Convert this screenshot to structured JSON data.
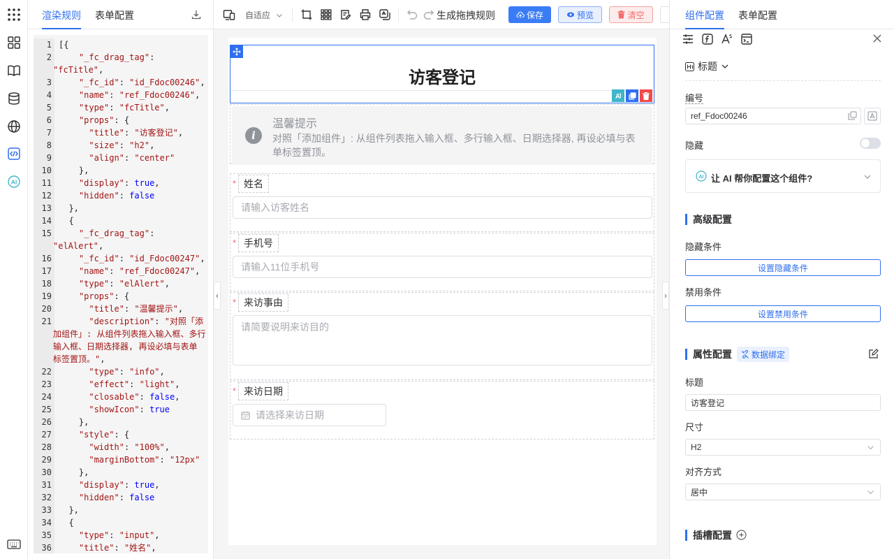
{
  "left_tabs": {
    "render_rules": "渲染规则",
    "form_config": "表单配置"
  },
  "code_lines": [
    {
      "n": "1",
      "parts": [
        [
          "t",
          "[{"
        ]
      ]
    },
    {
      "n": "2",
      "parts": [
        [
          "t",
          "    "
        ],
        [
          "k",
          "\"_fc_drag_tag\""
        ],
        [
          "t",
          ":"
        ]
      ]
    },
    {
      "n": "",
      "parts": [
        [
          "s",
          "\"fcTitle\""
        ],
        [
          "t",
          ","
        ]
      ]
    },
    {
      "n": "3",
      "parts": [
        [
          "t",
          "    "
        ],
        [
          "k",
          "\"_fc_id\""
        ],
        [
          "t",
          ": "
        ],
        [
          "s",
          "\"id_Fdoc00246\""
        ],
        [
          "t",
          ","
        ]
      ]
    },
    {
      "n": "4",
      "parts": [
        [
          "t",
          "    "
        ],
        [
          "k",
          "\"name\""
        ],
        [
          "t",
          ": "
        ],
        [
          "s",
          "\"ref_Fdoc00246\""
        ],
        [
          "t",
          ","
        ]
      ]
    },
    {
      "n": "5",
      "parts": [
        [
          "t",
          "    "
        ],
        [
          "k",
          "\"type\""
        ],
        [
          "t",
          ": "
        ],
        [
          "s",
          "\"fcTitle\""
        ],
        [
          "t",
          ","
        ]
      ]
    },
    {
      "n": "6",
      "parts": [
        [
          "t",
          "    "
        ],
        [
          "k",
          "\"props\""
        ],
        [
          "t",
          ": {"
        ]
      ]
    },
    {
      "n": "7",
      "parts": [
        [
          "t",
          "      "
        ],
        [
          "k",
          "\"title\""
        ],
        [
          "t",
          ": "
        ],
        [
          "s",
          "\"访客登记\""
        ],
        [
          "t",
          ","
        ]
      ]
    },
    {
      "n": "8",
      "parts": [
        [
          "t",
          "      "
        ],
        [
          "k",
          "\"size\""
        ],
        [
          "t",
          ": "
        ],
        [
          "s",
          "\"h2\""
        ],
        [
          "t",
          ","
        ]
      ]
    },
    {
      "n": "9",
      "parts": [
        [
          "t",
          "      "
        ],
        [
          "k",
          "\"align\""
        ],
        [
          "t",
          ": "
        ],
        [
          "s",
          "\"center\""
        ]
      ]
    },
    {
      "n": "10",
      "parts": [
        [
          "t",
          "    },"
        ]
      ]
    },
    {
      "n": "11",
      "parts": [
        [
          "t",
          "    "
        ],
        [
          "k",
          "\"display\""
        ],
        [
          "t",
          ": "
        ],
        [
          "b",
          "true"
        ],
        [
          "t",
          ","
        ]
      ]
    },
    {
      "n": "12",
      "parts": [
        [
          "t",
          "    "
        ],
        [
          "k",
          "\"hidden\""
        ],
        [
          "t",
          ": "
        ],
        [
          "b",
          "false"
        ]
      ]
    },
    {
      "n": "13",
      "parts": [
        [
          "t",
          "  },"
        ]
      ]
    },
    {
      "n": "14",
      "parts": [
        [
          "t",
          "  {"
        ]
      ]
    },
    {
      "n": "15",
      "parts": [
        [
          "t",
          "    "
        ],
        [
          "k",
          "\"_fc_drag_tag\""
        ],
        [
          "t",
          ":"
        ]
      ]
    },
    {
      "n": "",
      "parts": [
        [
          "s",
          "\"elAlert\""
        ],
        [
          "t",
          ","
        ]
      ]
    },
    {
      "n": "16",
      "parts": [
        [
          "t",
          "    "
        ],
        [
          "k",
          "\"_fc_id\""
        ],
        [
          "t",
          ": "
        ],
        [
          "s",
          "\"id_Fdoc00247\""
        ],
        [
          "t",
          ","
        ]
      ]
    },
    {
      "n": "17",
      "parts": [
        [
          "t",
          "    "
        ],
        [
          "k",
          "\"name\""
        ],
        [
          "t",
          ": "
        ],
        [
          "s",
          "\"ref_Fdoc00247\""
        ],
        [
          "t",
          ","
        ]
      ]
    },
    {
      "n": "18",
      "parts": [
        [
          "t",
          "    "
        ],
        [
          "k",
          "\"type\""
        ],
        [
          "t",
          ": "
        ],
        [
          "s",
          "\"elAlert\""
        ],
        [
          "t",
          ","
        ]
      ]
    },
    {
      "n": "19",
      "parts": [
        [
          "t",
          "    "
        ],
        [
          "k",
          "\"props\""
        ],
        [
          "t",
          ": {"
        ]
      ]
    },
    {
      "n": "20",
      "parts": [
        [
          "t",
          "      "
        ],
        [
          "k",
          "\"title\""
        ],
        [
          "t",
          ": "
        ],
        [
          "s",
          "\"温馨提示\""
        ],
        [
          "t",
          ","
        ]
      ]
    },
    {
      "n": "21",
      "parts": [
        [
          "t",
          "      "
        ],
        [
          "k",
          "\"description\""
        ],
        [
          "t",
          ": "
        ],
        [
          "s",
          "\"对照「添"
        ]
      ]
    },
    {
      "n": "",
      "parts": [
        [
          "s",
          "加组件」: 从组件列表拖入输入框、多行"
        ]
      ]
    },
    {
      "n": "",
      "parts": [
        [
          "s",
          "输入框、日期选择器, 再设必填与表单"
        ]
      ]
    },
    {
      "n": "",
      "parts": [
        [
          "s",
          "标签置顶。\""
        ],
        [
          "t",
          ","
        ]
      ]
    },
    {
      "n": "22",
      "parts": [
        [
          "t",
          "      "
        ],
        [
          "k",
          "\"type\""
        ],
        [
          "t",
          ": "
        ],
        [
          "s",
          "\"info\""
        ],
        [
          "t",
          ","
        ]
      ]
    },
    {
      "n": "23",
      "parts": [
        [
          "t",
          "      "
        ],
        [
          "k",
          "\"effect\""
        ],
        [
          "t",
          ": "
        ],
        [
          "s",
          "\"light\""
        ],
        [
          "t",
          ","
        ]
      ]
    },
    {
      "n": "24",
      "parts": [
        [
          "t",
          "      "
        ],
        [
          "k",
          "\"closable\""
        ],
        [
          "t",
          ": "
        ],
        [
          "b",
          "false"
        ],
        [
          "t",
          ","
        ]
      ]
    },
    {
      "n": "25",
      "parts": [
        [
          "t",
          "      "
        ],
        [
          "k",
          "\"showIcon\""
        ],
        [
          "t",
          ": "
        ],
        [
          "b",
          "true"
        ]
      ]
    },
    {
      "n": "26",
      "parts": [
        [
          "t",
          "    },"
        ]
      ]
    },
    {
      "n": "27",
      "parts": [
        [
          "t",
          "    "
        ],
        [
          "k",
          "\"style\""
        ],
        [
          "t",
          ": {"
        ]
      ]
    },
    {
      "n": "28",
      "parts": [
        [
          "t",
          "      "
        ],
        [
          "k",
          "\"width\""
        ],
        [
          "t",
          ": "
        ],
        [
          "s",
          "\"100%\""
        ],
        [
          "t",
          ","
        ]
      ]
    },
    {
      "n": "29",
      "parts": [
        [
          "t",
          "      "
        ],
        [
          "k",
          "\"marginBottom\""
        ],
        [
          "t",
          ": "
        ],
        [
          "s",
          "\"12px\""
        ]
      ]
    },
    {
      "n": "30",
      "parts": [
        [
          "t",
          "    },"
        ]
      ]
    },
    {
      "n": "31",
      "parts": [
        [
          "t",
          "    "
        ],
        [
          "k",
          "\"display\""
        ],
        [
          "t",
          ": "
        ],
        [
          "b",
          "true"
        ],
        [
          "t",
          ","
        ]
      ]
    },
    {
      "n": "32",
      "parts": [
        [
          "t",
          "    "
        ],
        [
          "k",
          "\"hidden\""
        ],
        [
          "t",
          ": "
        ],
        [
          "b",
          "false"
        ]
      ]
    },
    {
      "n": "33",
      "parts": [
        [
          "t",
          "  },"
        ]
      ]
    },
    {
      "n": "34",
      "parts": [
        [
          "t",
          "  {"
        ]
      ]
    },
    {
      "n": "35",
      "parts": [
        [
          "t",
          "    "
        ],
        [
          "k",
          "\"type\""
        ],
        [
          "t",
          ": "
        ],
        [
          "s",
          "\"input\""
        ],
        [
          "t",
          ","
        ]
      ]
    },
    {
      "n": "36",
      "parts": [
        [
          "t",
          "    "
        ],
        [
          "k",
          "\"title\""
        ],
        [
          "t",
          ": "
        ],
        [
          "s",
          "\"姓名\""
        ],
        [
          "t",
          ","
        ]
      ]
    }
  ],
  "toolbar": {
    "adaptive": "自适应",
    "generate": "生成拖拽规则",
    "save": "保存",
    "preview": "预览",
    "clear": "清空"
  },
  "form": {
    "title": "访客登记",
    "alert_title": "温馨提示",
    "alert_desc": "对照「添加组件」: 从组件列表拖入输入框、多行输入框、日期选择器, 再设必填与表单标签置顶。",
    "alert_icon": "i",
    "required_mark": "*",
    "fields": {
      "name_label": "姓名",
      "name_placeholder": "请输入访客姓名",
      "phone_label": "手机号",
      "phone_placeholder": "请输入11位手机号",
      "reason_label": "来访事由",
      "reason_placeholder": "请简要说明来访目的",
      "date_label": "来访日期",
      "date_placeholder": "请选择来访日期"
    }
  },
  "right": {
    "tab_component": "组件配置",
    "tab_form": "表单配置",
    "component_type": "标题",
    "id_label": "编号",
    "id_value": "ref_Fdoc00246",
    "hidden_label": "隐藏",
    "ai_prompt": "让 AI 帮你配置这个组件?",
    "advanced": "高级配置",
    "hide_condition": "隐藏条件",
    "set_hide_condition": "设置隐藏条件",
    "disable_condition": "禁用条件",
    "set_disable_condition": "设置禁用条件",
    "props": "属性配置",
    "data_binding": "数据绑定",
    "title_label": "标题",
    "title_value": "访客登记",
    "size_label": "尺寸",
    "size_value": "H2",
    "align_label": "对齐方式",
    "align_value": "居中",
    "slot": "插槽配置"
  },
  "colors": {
    "accent": "#2f6fee",
    "danger": "#f56c6c",
    "ai": "#3fb6c9"
  }
}
